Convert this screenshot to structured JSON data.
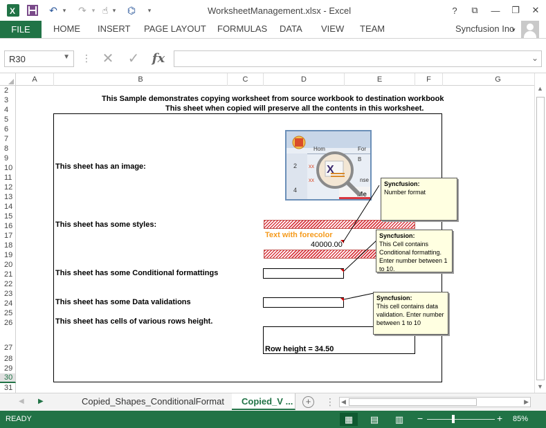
{
  "title": {
    "text": "WorksheetManagement.xlsx - Excel"
  },
  "ribbon": {
    "file": "FILE",
    "tabs": [
      "HOME",
      "INSERT",
      "PAGE LAYOUT",
      "FORMULAS",
      "DATA",
      "VIEW",
      "TEAM"
    ],
    "account": "Syncfusion Inc"
  },
  "namebox": {
    "value": "R30"
  },
  "columns": [
    "A",
    "B",
    "C",
    "D",
    "E",
    "F",
    "G"
  ],
  "rows": [
    "2",
    "3",
    "4",
    "5",
    "6",
    "7",
    "8",
    "9",
    "10",
    "11",
    "12",
    "13",
    "14",
    "15",
    "16",
    "17",
    "18",
    "19",
    "20",
    "21",
    "22",
    "23",
    "24",
    "25",
    "26",
    "27",
    "28",
    "29",
    "30",
    "31"
  ],
  "selected_row": "30",
  "sheet": {
    "header1": "This Sample demonstrates copying worksheet from source workbook to destination workbook",
    "header2": "This sheet when copied will preserve all the contents in this worksheet.",
    "image_label": "This sheet has an image:",
    "styles_label": "This sheet has some styles:",
    "forecolor_text": "Text with forecolor",
    "number_value": "40000.00",
    "cond_label": "This sheet has some Conditional formattings",
    "validation_label": "This sheet has some Data validations",
    "rowheight_label": "This sheet has cells of various rows height.",
    "rowheight_value": "Row height = 34.50"
  },
  "notes": [
    {
      "title": "Syncfusion:",
      "body": "Number format"
    },
    {
      "title": "Syncfusion:",
      "body": "This Cell contains Conditional formatting. Enter number between 1 to 10."
    },
    {
      "title": "Syncfusion:",
      "body": "This cell contains data validation. Enter number between 1 to 10"
    }
  ],
  "sheet_tabs": [
    "Copied_Shapes_ConditionalFormat",
    "Copied_V ..."
  ],
  "status": {
    "ready": "READY",
    "zoom": "85%"
  },
  "colors": {
    "accent": "#217346",
    "forecolor": "#f59a1b",
    "hatch": "#d9363e"
  }
}
